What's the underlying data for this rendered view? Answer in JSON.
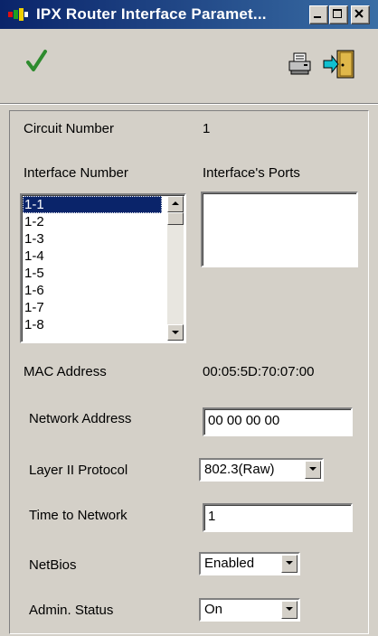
{
  "window": {
    "title": "IPX Router Interface Paramet...",
    "min_label": "",
    "max_label": "",
    "close_label": ""
  },
  "toolbar": {
    "icons": [
      "checkmark-icon",
      "printer-icon",
      "exit-door-icon"
    ],
    "check_color": "#2e8b2e"
  },
  "form": {
    "circuit_number_label": "Circuit Number",
    "circuit_number_value": "1",
    "interface_number_label": "Interface Number",
    "interface_ports_label": "Interface's Ports",
    "interfaces": [
      "1-1",
      "1-2",
      "1-3",
      "1-4",
      "1-5",
      "1-6",
      "1-7",
      "1-8"
    ],
    "selected_interface": "1-1",
    "mac_label": "MAC Address",
    "mac_value": "00:05:5D:70:07:00",
    "network_address_label": "Network Address",
    "network_address_value": "00 00 00 00",
    "layer2_label": "Layer II Protocol",
    "layer2_value": "802.3(Raw)",
    "time_label": "Time to Network",
    "time_value": "1",
    "netbios_label": "NetBios",
    "netbios_value": "Enabled",
    "admin_label": "Admin. Status",
    "admin_value": "On"
  }
}
